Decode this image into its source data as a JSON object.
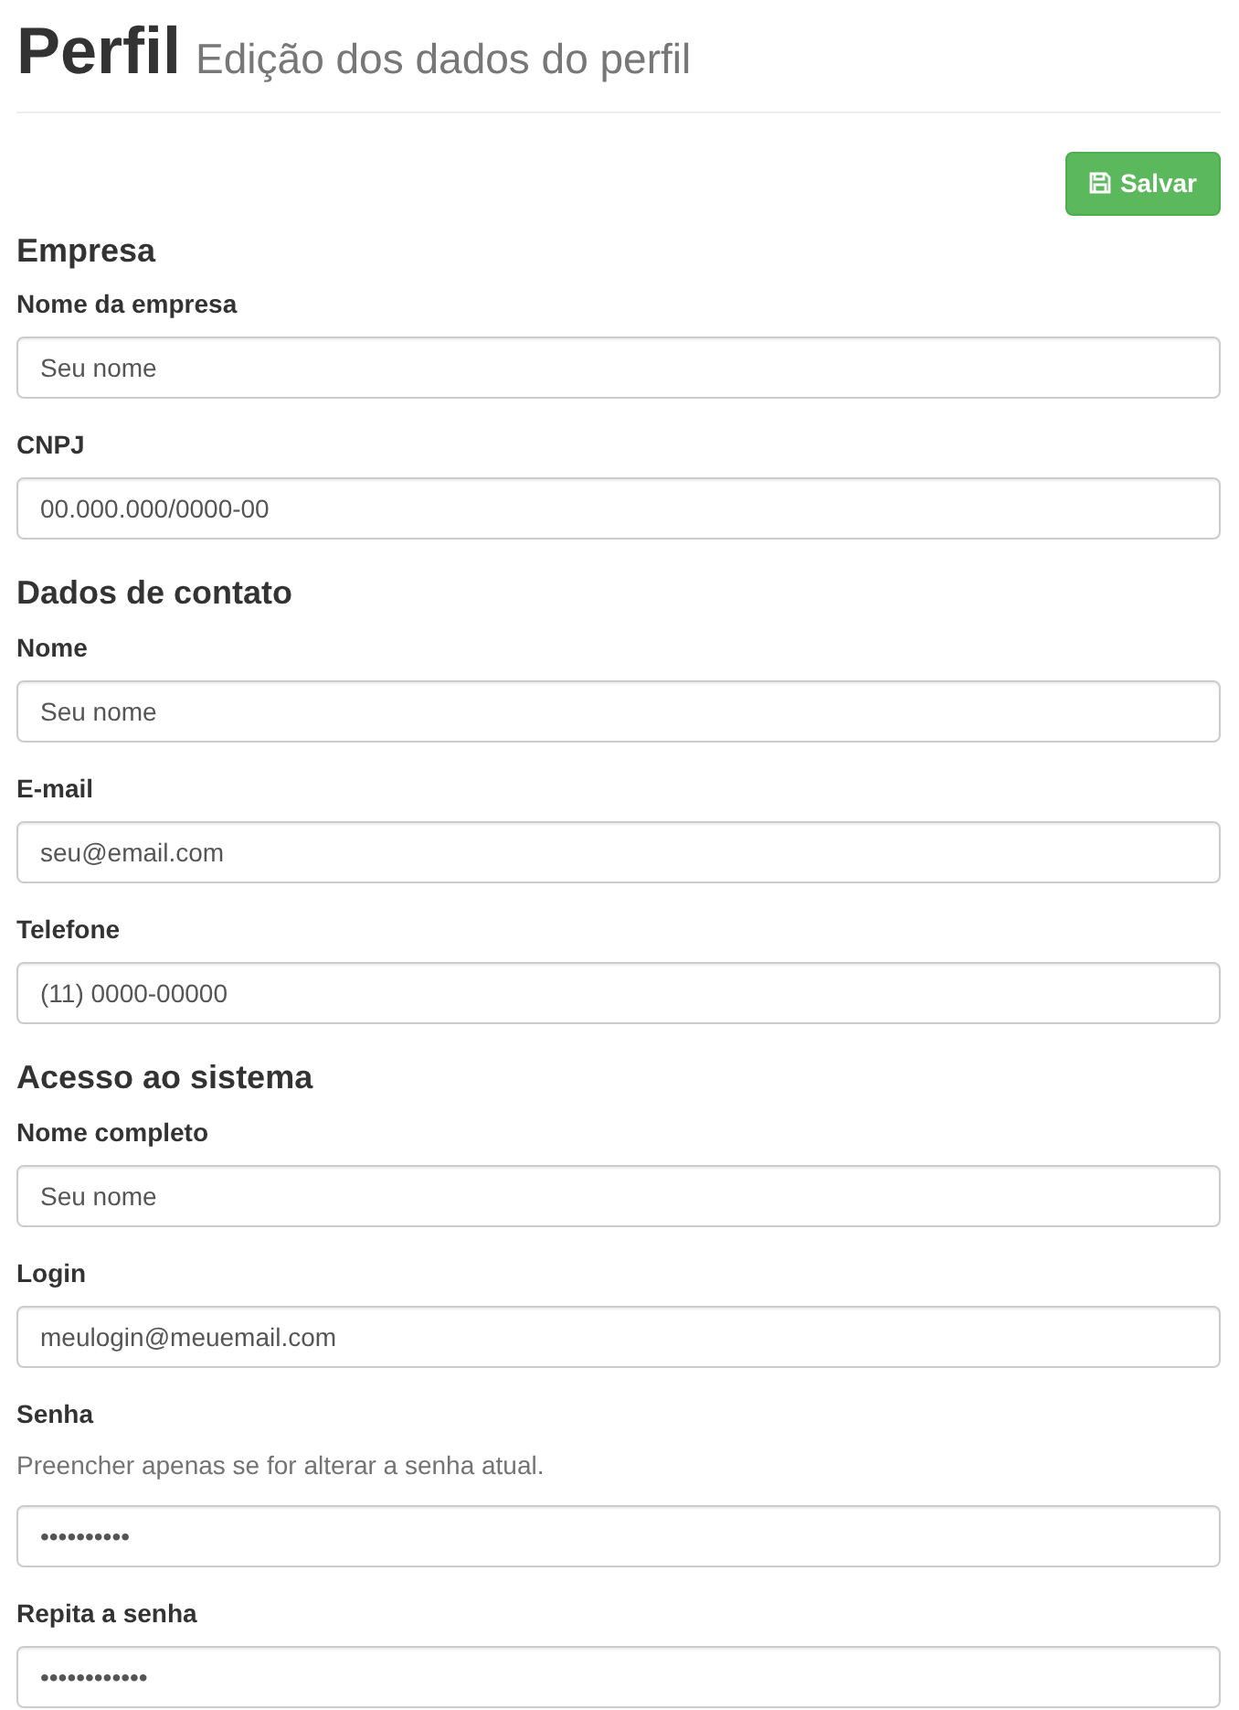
{
  "header": {
    "title": "Perfil",
    "subtitle": "Edição dos dados do perfil"
  },
  "save_button": {
    "label": "Salvar"
  },
  "sections": [
    {
      "heading": "Empresa",
      "fields": [
        {
          "label": "Nome da empresa",
          "value": "Seu nome"
        },
        {
          "label": "CNPJ",
          "value": "00.000.000/0000-00"
        }
      ]
    },
    {
      "heading": "Dados de contato",
      "fields": [
        {
          "label": "Nome",
          "value": "Seu nome"
        },
        {
          "label": "E-mail",
          "value": "seu@email.com"
        },
        {
          "label": "Telefone",
          "value": "(11) 0000-00000"
        }
      ]
    },
    {
      "heading": "Acesso ao sistema",
      "fields": [
        {
          "label": "Nome completo",
          "value": "Seu nome"
        },
        {
          "label": "Login",
          "value": "meulogin@meuemail.com"
        },
        {
          "label": "Senha",
          "help": "Preencher apenas se for alterar a senha atual.",
          "value": "••••••••••"
        },
        {
          "label": "Repita a senha",
          "value": "••••••••••••"
        }
      ]
    }
  ]
}
